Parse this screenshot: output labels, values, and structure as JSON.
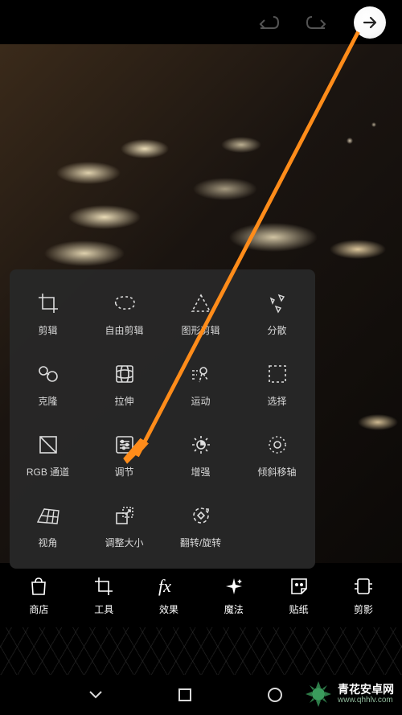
{
  "topbar": {
    "undo": "undo",
    "redo": "redo",
    "forward": "forward"
  },
  "tool_panel": {
    "rows": [
      [
        {
          "label": "剪辑",
          "icon": "crop"
        },
        {
          "label": "自由剪辑",
          "icon": "lasso"
        },
        {
          "label": "图形剪辑",
          "icon": "shape-crop"
        },
        {
          "label": "分散",
          "icon": "scatter"
        }
      ],
      [
        {
          "label": "克隆",
          "icon": "clone"
        },
        {
          "label": "拉伸",
          "icon": "stretch"
        },
        {
          "label": "运动",
          "icon": "motion"
        },
        {
          "label": "选择",
          "icon": "select"
        }
      ],
      [
        {
          "label": "RGB 通道",
          "icon": "rgb"
        },
        {
          "label": "调节",
          "icon": "adjust"
        },
        {
          "label": "增强",
          "icon": "enhance"
        },
        {
          "label": "倾斜移轴",
          "icon": "tilt-shift"
        }
      ],
      [
        {
          "label": "视角",
          "icon": "perspective"
        },
        {
          "label": "调整大小",
          "icon": "resize"
        },
        {
          "label": "翻转/旋转",
          "icon": "flip-rotate"
        }
      ]
    ]
  },
  "bottom_bar": [
    {
      "label": "商店",
      "icon": "shop"
    },
    {
      "label": "工具",
      "icon": "tool"
    },
    {
      "label": "效果",
      "icon": "fx"
    },
    {
      "label": "魔法",
      "icon": "magic"
    },
    {
      "label": "贴纸",
      "icon": "sticker"
    },
    {
      "label": "剪影",
      "icon": "silhouette"
    }
  ],
  "watermark": {
    "title": "青花安卓网",
    "url": "www.qhhlv.com"
  }
}
